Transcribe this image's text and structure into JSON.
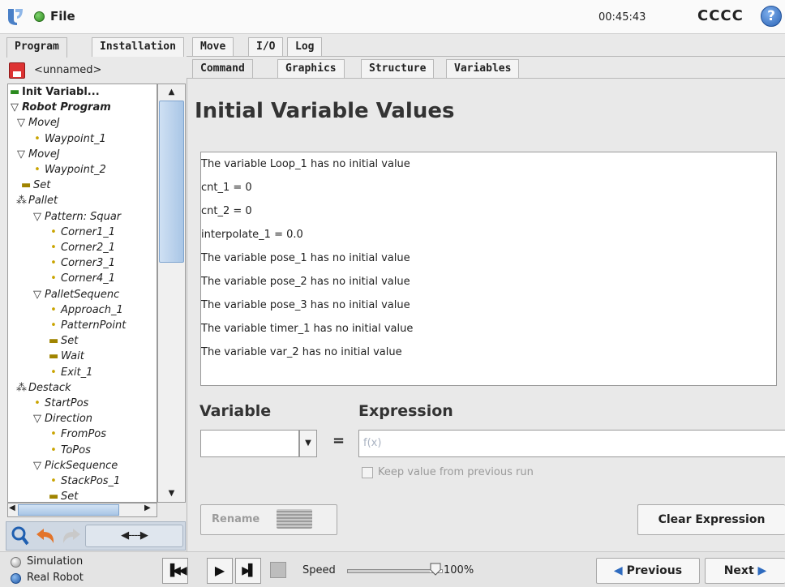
{
  "header": {
    "file_menu": "File",
    "clock": "00:45:43",
    "robot_name": "CCCC",
    "help_glyph": "?"
  },
  "top_tabs": [
    "Program",
    "Installation",
    "Move",
    "I/O",
    "Log"
  ],
  "program_panel": {
    "program_name": "<unnamed>",
    "tree": [
      {
        "label": "Init Variabl...",
        "glyph": "▬",
        "selected": true
      },
      {
        "label": "Robot Program",
        "glyph": "▽"
      },
      {
        "label": "MoveJ",
        "glyph": "▽"
      },
      {
        "label": "Waypoint_1",
        "glyph": "•"
      },
      {
        "label": "MoveJ",
        "glyph": "▽"
      },
      {
        "label": "Waypoint_2",
        "glyph": "•"
      },
      {
        "label": "Set",
        "glyph": "▬"
      },
      {
        "label": "Pallet",
        "glyph": "⁂"
      },
      {
        "label": "Pattern: Squar",
        "glyph": "▽"
      },
      {
        "label": "Corner1_1",
        "glyph": "•"
      },
      {
        "label": "Corner2_1",
        "glyph": "•"
      },
      {
        "label": "Corner3_1",
        "glyph": "•"
      },
      {
        "label": "Corner4_1",
        "glyph": "•"
      },
      {
        "label": "PalletSequenc",
        "glyph": "▽"
      },
      {
        "label": "Approach_1",
        "glyph": "•"
      },
      {
        "label": "PatternPoint",
        "glyph": "•"
      },
      {
        "label": "Set",
        "glyph": "▬"
      },
      {
        "label": "Wait",
        "glyph": "▬"
      },
      {
        "label": "Exit_1",
        "glyph": "•"
      },
      {
        "label": "Destack",
        "glyph": "⁂"
      },
      {
        "label": "StartPos",
        "glyph": "•"
      },
      {
        "label": "Direction",
        "glyph": "▽"
      },
      {
        "label": "FromPos",
        "glyph": "•"
      },
      {
        "label": "ToPos",
        "glyph": "•"
      },
      {
        "label": "PickSequence",
        "glyph": "▽"
      },
      {
        "label": "StackPos_1",
        "glyph": "•"
      },
      {
        "label": "Set",
        "glyph": "▬"
      }
    ],
    "tools": {
      "search_icon": "search-icon",
      "undo_icon": "undo-icon",
      "redo_icon": "redo-icon",
      "move_label": "◀----▶"
    }
  },
  "sub_tabs": [
    "Command",
    "Graphics",
    "Structure",
    "Variables"
  ],
  "command": {
    "heading": "Initial Variable Values",
    "variables": [
      "The variable Loop_1 has no initial value",
      "cnt_1 = 0",
      "cnt_2 = 0",
      "interpolate_1 = 0.0",
      "The variable pose_1 has no initial value",
      "The variable pose_2 has no initial value",
      "The variable pose_3 has no initial value",
      "The variable timer_1 has no initial value",
      "The variable var_2 has no initial value"
    ],
    "variable_label": "Variable",
    "expression_label": "Expression",
    "equals": "=",
    "expression_placeholder": "f(x)",
    "keep_value_label": "Keep value from previous run",
    "rename_label": "Rename",
    "clear_label": "Clear Expression"
  },
  "footer": {
    "simulation_label": "Simulation",
    "real_robot_label": "Real Robot",
    "speed_label": "Speed",
    "speed_value": "100%",
    "speed_fraction": 1.0,
    "previous_label": "Previous",
    "next_label": "Next"
  },
  "colors": {
    "accent": "#2e6bbf",
    "background": "#e9e9e9"
  }
}
